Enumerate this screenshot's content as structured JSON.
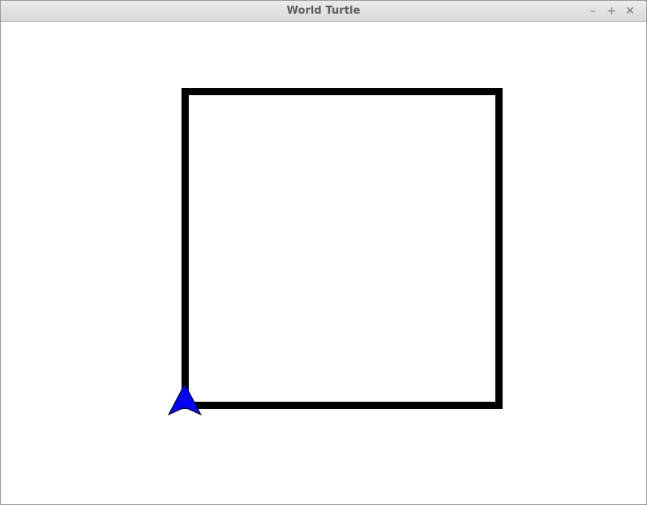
{
  "window": {
    "title": "World Turtle",
    "controls": {
      "minimize": "–",
      "maximize": "+",
      "close": "✕"
    }
  },
  "canvas": {
    "background": "#ffffff",
    "pen_color": "#000000",
    "turtle_color": "#0000ff",
    "turtle_heading": "north",
    "drawn_shape": "square"
  }
}
